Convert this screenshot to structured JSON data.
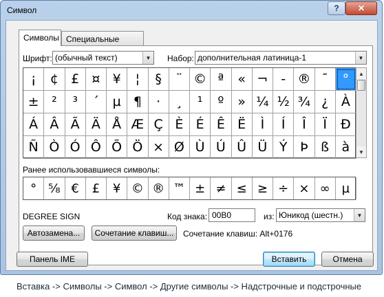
{
  "window": {
    "title": "Символ",
    "help": "?",
    "close": "✕"
  },
  "tabs": [
    {
      "label": "Символы"
    },
    {
      "label": "Специальные знаки"
    }
  ],
  "font": {
    "label": "Шрифт:",
    "value": "(обычный текст)"
  },
  "subset": {
    "label": "Набор:",
    "value": "дополнительная латиница-1"
  },
  "grid": [
    "¡",
    "¢",
    "£",
    "¤",
    "¥",
    "¦",
    "§",
    "¨",
    "©",
    "ª",
    "«",
    "¬",
    "-",
    "®",
    "¯",
    "°",
    "±",
    "²",
    "³",
    "´",
    "µ",
    "¶",
    "·",
    "¸",
    "¹",
    "º",
    "»",
    "¼",
    "½",
    "¾",
    "¿",
    "À",
    "Á",
    "Â",
    "Ã",
    "Ä",
    "Å",
    "Æ",
    "Ç",
    "È",
    "É",
    "Ê",
    "Ë",
    "Ì",
    "Í",
    "Î",
    "Ï",
    "Ð",
    "Ñ",
    "Ò",
    "Ó",
    "Ô",
    "Õ",
    "Ö",
    "×",
    "Ø",
    "Ù",
    "Ú",
    "Û",
    "Ü",
    "Ý",
    "Þ",
    "ß",
    "à"
  ],
  "selected_symbol": "°",
  "recent": {
    "label": "Ранее использовавшиеся символы:",
    "symbols": [
      "°",
      "⅝",
      "€",
      "£",
      "¥",
      "©",
      "®",
      "™",
      "±",
      "≠",
      "≤",
      "≥",
      "÷",
      "×",
      "∞",
      "µ"
    ]
  },
  "symbol_name": "DEGREE SIGN",
  "char_code": {
    "label": "Код знака:",
    "value": "00B0"
  },
  "from": {
    "label": "из:",
    "value": "Юникод (шестн.)"
  },
  "buttons": {
    "autocorrect": "Автозамена...",
    "shortcut_key": "Сочетание клавиш...",
    "ime_pad": "Панель IME",
    "insert": "Вставить",
    "cancel": "Отмена"
  },
  "shortcut_text": "Сочетание клавиш: Alt+0176",
  "caption": "Вставка -> Символы -> Символ -> Другие символы -> Надстрочные и подстрочные"
}
